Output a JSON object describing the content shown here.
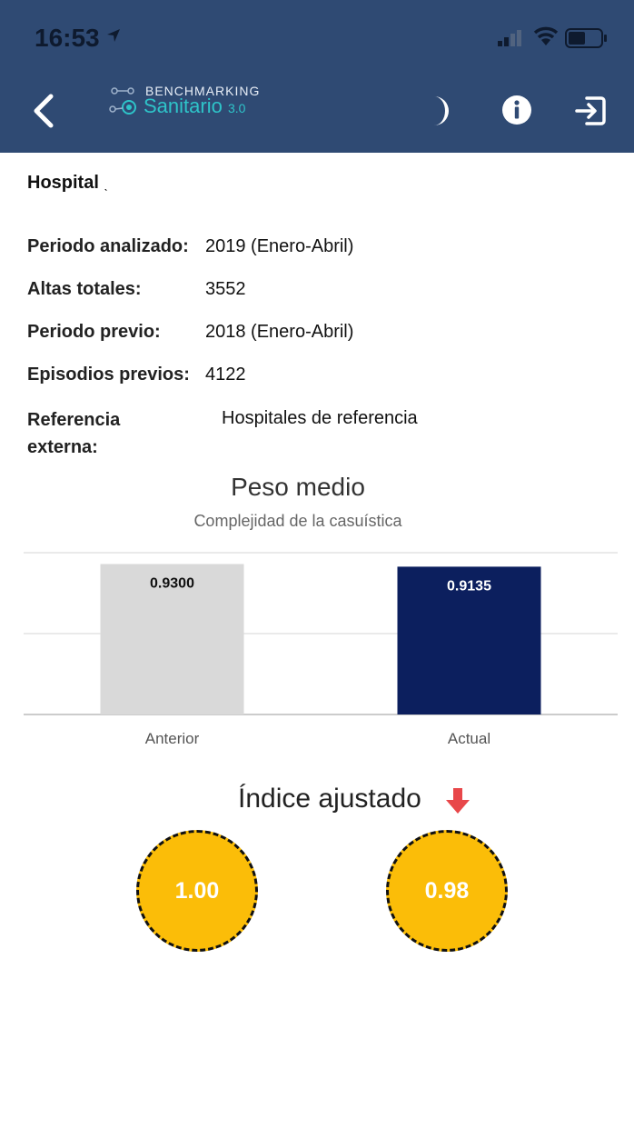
{
  "status_bar": {
    "time": "16:53"
  },
  "header": {
    "logo_top": "BENCHMARKING",
    "logo_bottom": "Sanitario",
    "logo_version": "3.0",
    "icons": [
      "back-icon",
      "moon-icon",
      "info-icon",
      "exit-icon"
    ]
  },
  "hospital": {
    "label": "Hospital",
    "mark": "ˎ"
  },
  "details": {
    "periodo_analizado": {
      "label": "Periodo analizado:",
      "value": "2019 (Enero-Abril)"
    },
    "altas_totales": {
      "label": "Altas totales:",
      "value": "3552"
    },
    "periodo_previo": {
      "label": "Periodo previo:",
      "value": "2018 (Enero-Abril)"
    },
    "episodios_previos": {
      "label": "Episodios previos:",
      "value": "4122"
    },
    "referencia_externa": {
      "label_line1": "Referencia",
      "label_line2": "externa:",
      "value": "Hospitales de referencia"
    }
  },
  "chart_data": {
    "type": "bar",
    "title": "Peso medio",
    "subtitle": "Complejidad de la casuística",
    "categories": [
      "Anterior",
      "Actual"
    ],
    "values": [
      0.93,
      0.9135
    ],
    "value_labels": [
      "0.9300",
      "0.9135"
    ],
    "colors": [
      "#d9d9d9",
      "#0c1f5e"
    ],
    "ylim": [
      0,
      1.0
    ],
    "grid": true
  },
  "index": {
    "title": "Índice ajustado",
    "trend": "down",
    "trend_color": "#e8474a",
    "circle_color": "#fbbd08",
    "values": [
      "1.00",
      "0.98"
    ]
  }
}
